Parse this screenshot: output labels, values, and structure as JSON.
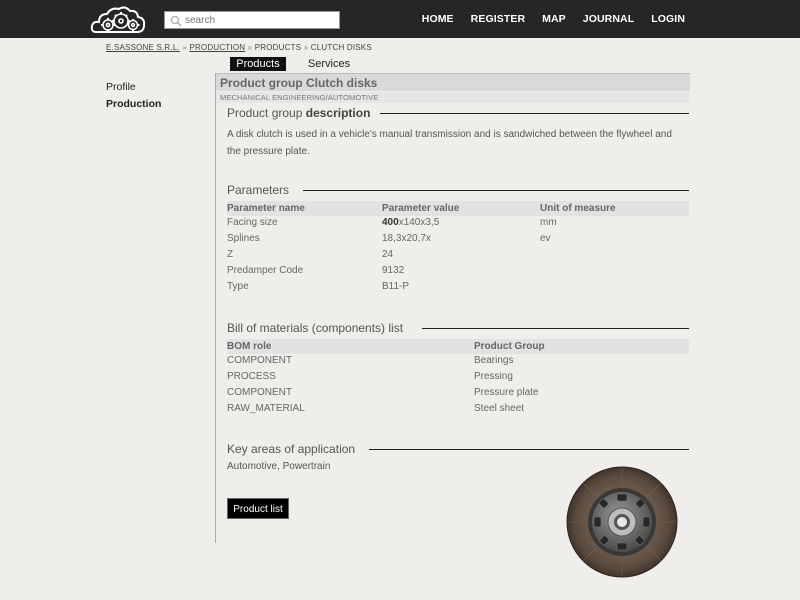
{
  "header": {
    "search_placeholder": "search",
    "nav": [
      "HOME",
      "REGISTER",
      "MAP",
      "JOURNAL",
      "LOGIN"
    ]
  },
  "breadcrumb": {
    "company": "E.SASSONE S.R.L.",
    "production": "PRODUCTION",
    "products": "PRODUCTS",
    "current": "CLUTCH DISKS",
    "separator": "»"
  },
  "tabs": {
    "products": "Products",
    "services": "Services"
  },
  "sidebar": {
    "profile": "Profile",
    "production": "Production"
  },
  "group": {
    "title": "Product group Clutch disks",
    "category": "MECHANICAL ENGINEERING/AUTOMOTIVE"
  },
  "description": {
    "heading_prefix": "Product group",
    "heading_bold": "description",
    "text": "A disk clutch is used in a vehicle's manual transmission and is sandwiched between the flywheel and the pressure plate."
  },
  "parameters": {
    "heading": "Parameters",
    "columns": [
      "Parameter name",
      "Parameter value",
      "Unit of measure"
    ],
    "rows": [
      {
        "name": "Facing size",
        "value_bold": "400",
        "value": "x140x3,5",
        "unit": "mm"
      },
      {
        "name": "Splines",
        "value_bold": "",
        "value": "18,3x20,7x",
        "unit": "ev"
      },
      {
        "name": "Z",
        "value_bold": "",
        "value": "24",
        "unit": ""
      },
      {
        "name": "Predamper Code",
        "value_bold": "",
        "value": "9132",
        "unit": ""
      },
      {
        "name": "Type",
        "value_bold": "",
        "value": "B11-P",
        "unit": ""
      }
    ]
  },
  "bom": {
    "heading": "Bill of materials (components) list",
    "columns": [
      "BOM role",
      "Product Group"
    ],
    "rows": [
      {
        "role": "COMPONENT",
        "group": "Bearings"
      },
      {
        "role": "PROCESS",
        "group": "Pressing"
      },
      {
        "role": "COMPONENT",
        "group": "Pressure plate"
      },
      {
        "role": "RAW_MATERIAL",
        "group": "Steel sheet"
      }
    ]
  },
  "areas": {
    "heading": "Key areas of application",
    "text": "Automotive, Powertrain"
  },
  "actions": {
    "product_list": "Product list"
  },
  "colors": {
    "topbar": "#262626",
    "background": "#efeeea",
    "button": "#000000"
  },
  "icons": {
    "logo": "cloud-gears-logo",
    "search": "search-icon",
    "product_image": "clutch-disk-image"
  }
}
